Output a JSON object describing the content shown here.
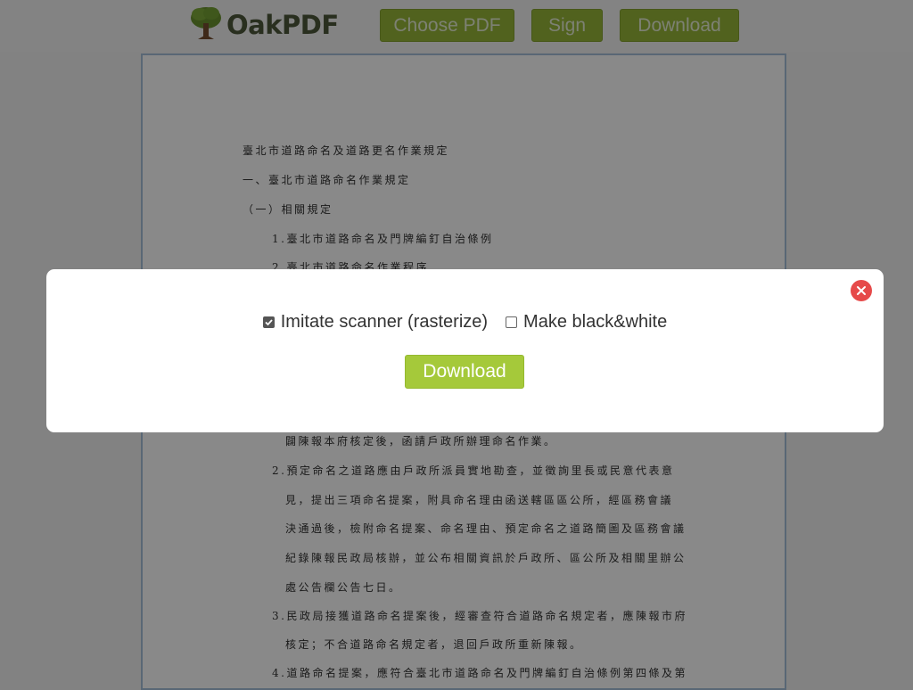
{
  "header": {
    "logo_text": "OakPDF",
    "logo_icon": "oak-tree-icon",
    "buttons": {
      "choose": "Choose PDF",
      "sign": "Sign",
      "download": "Download"
    }
  },
  "document": {
    "lines": [
      "臺北市道路命名及道路更名作業規定",
      "一、臺北市道路命名作業規定",
      "（一）相關規定",
      "1.臺北市道路命名及門牌編釘自治條例",
      "2.臺北市道路命名作業程序",
      "闢陳報本府核定後，函請戶政所辦理命名作業。",
      "2.預定命名之道路應由戶政所派員實地勘查，並徵詢里長或民意代表意",
      "見，提出三項命名提案，附具命名理由函送轄區區公所，經區務會議",
      "決通過後，檢附命名提案、命名理由、預定命名之道路簡圖及區務會議",
      "紀錄陳報民政局核辦，並公布相關資訊於戶政所、區公所及相關里辦公",
      "處公告欄公告七日。",
      "3.民政局接獲道路命名提案後，經審查符合道路命名規定者，應陳報市府",
      "核定；不合道路命名規定者，退回戶政所重新陳報。",
      "4.道路命名提案，應符合臺北市道路命名及門牌編釘自治條例第四條及第"
    ]
  },
  "modal": {
    "options": {
      "imitate_scanner": {
        "label": "Imitate scanner (rasterize)",
        "checked": true
      },
      "black_white": {
        "label": "Make black&white",
        "checked": false
      }
    },
    "download_label": "Download",
    "close_icon": "close-icon"
  },
  "colors": {
    "brand_green": "#8fb129",
    "modal_button_green": "#a5c93a",
    "close_red": "#e64a4a",
    "page_border": "#9fbad6"
  }
}
